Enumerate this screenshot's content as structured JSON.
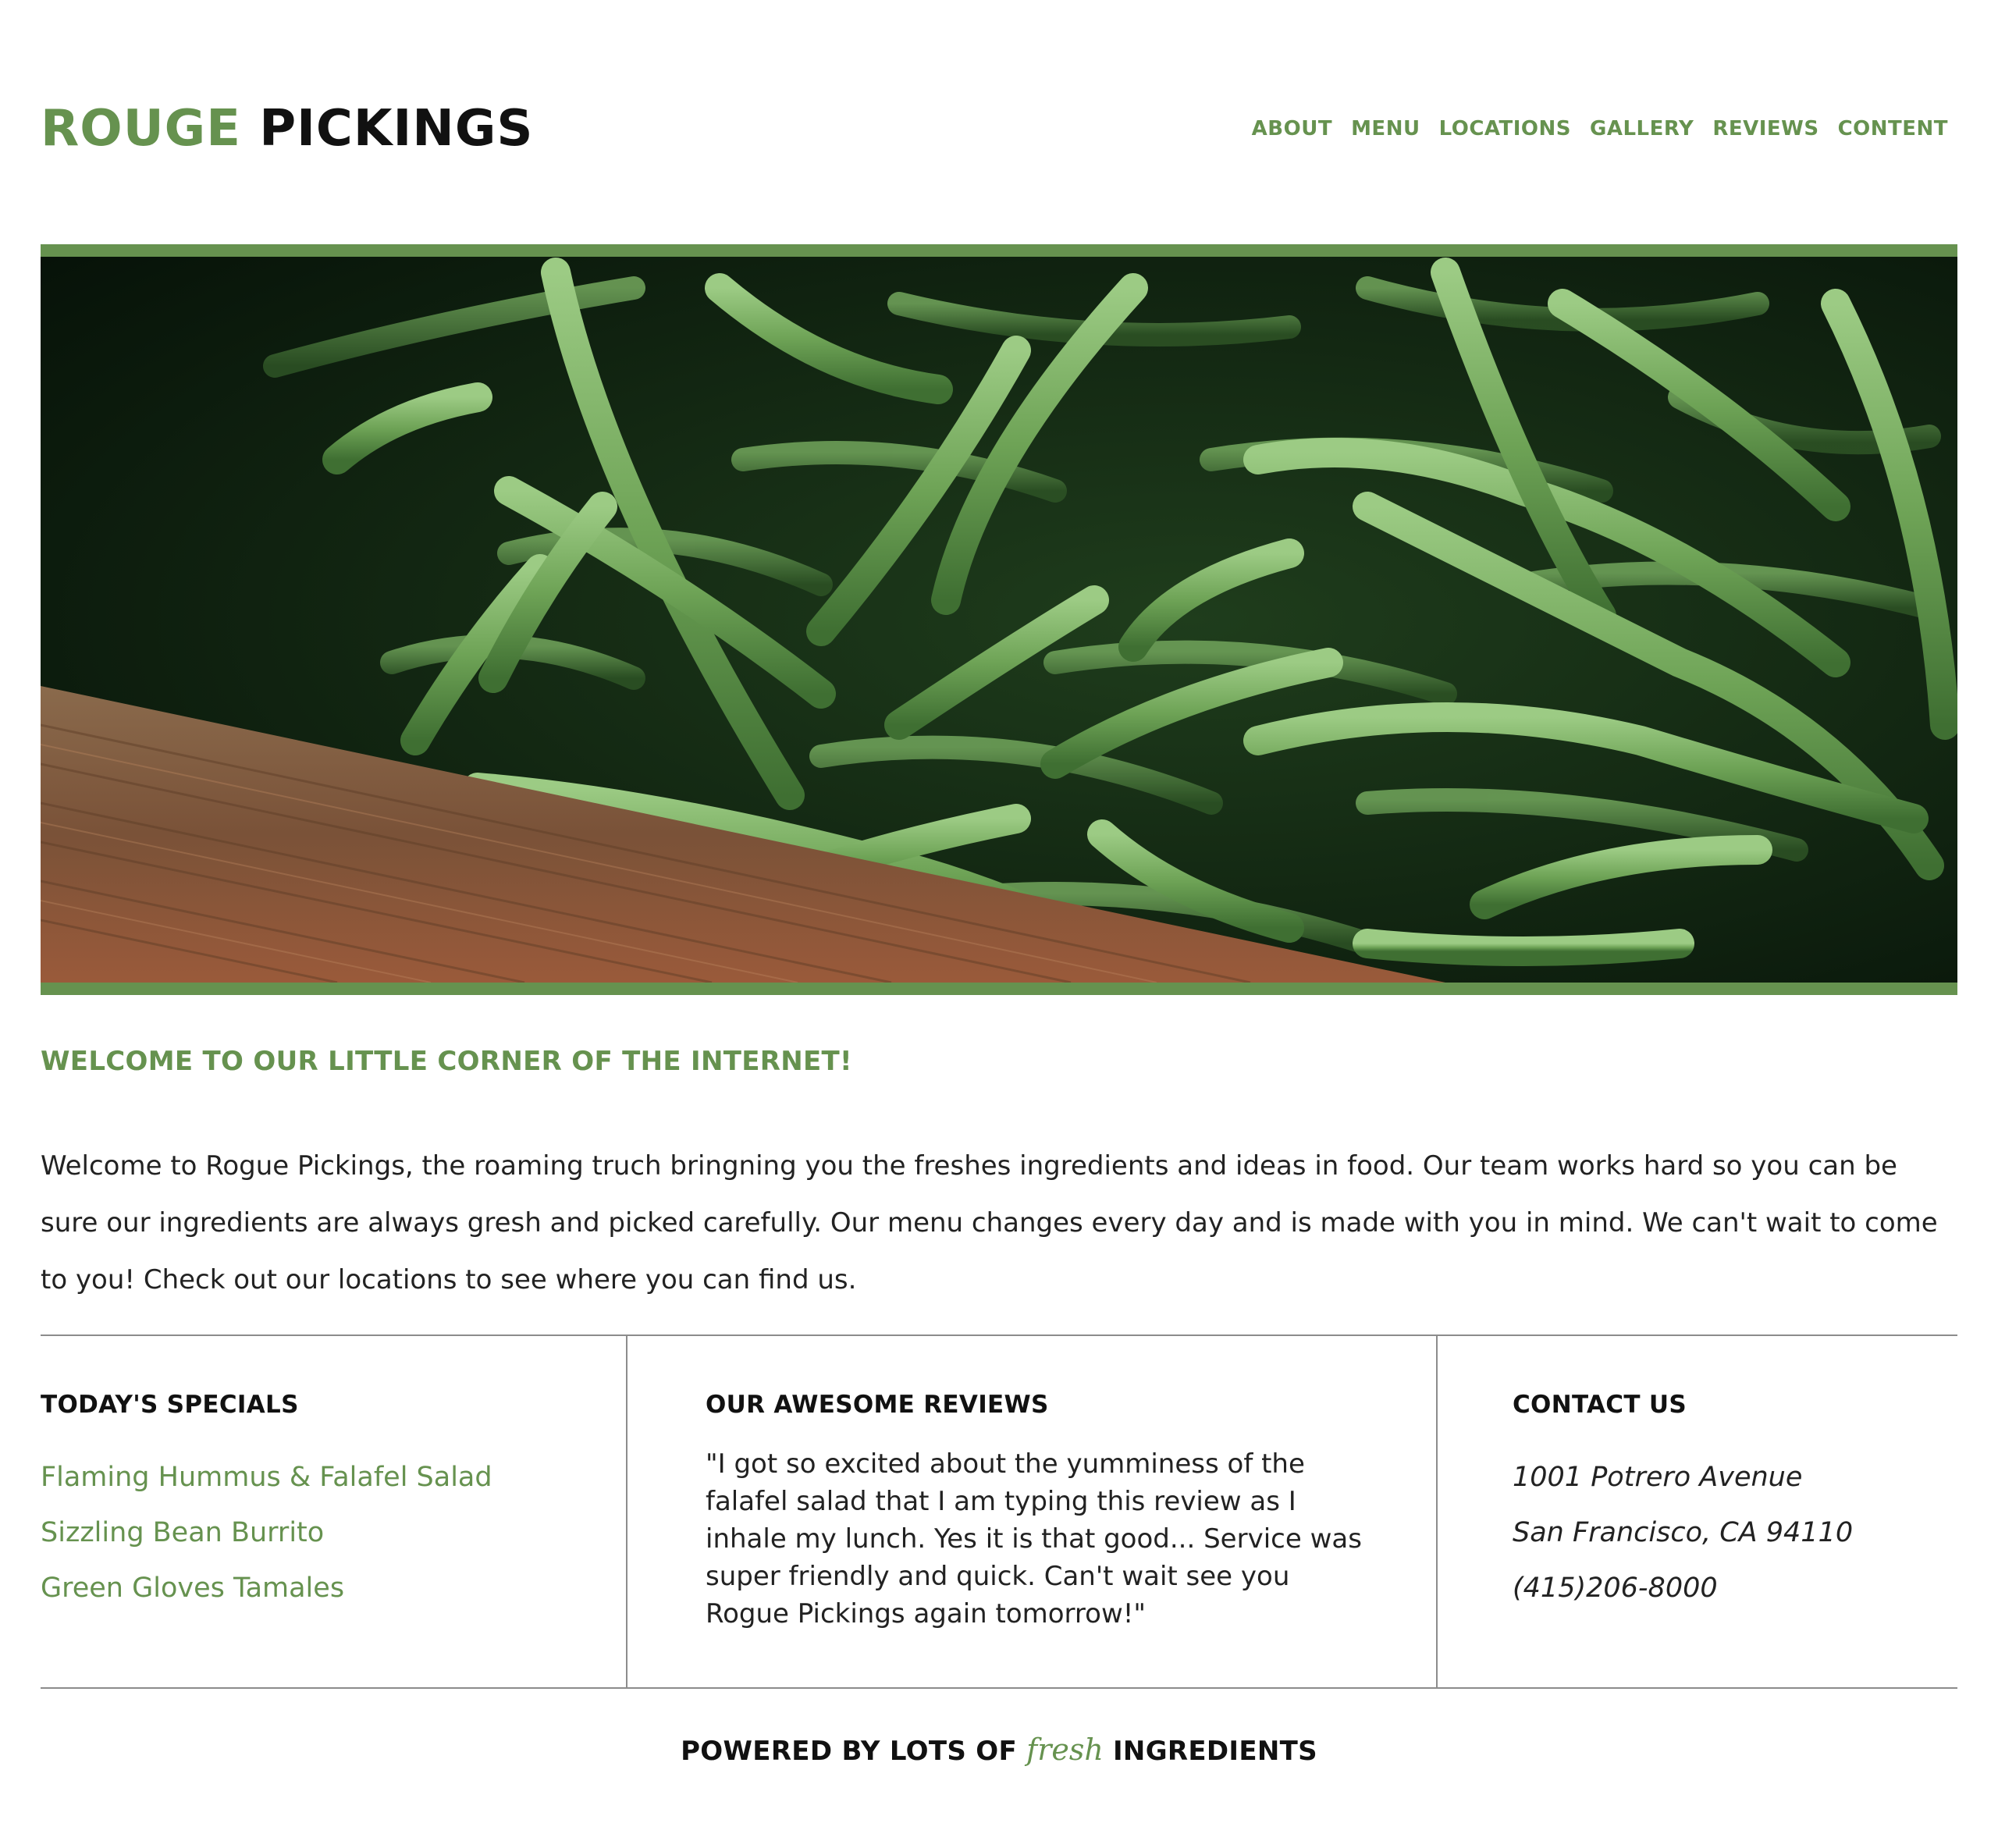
{
  "brand": {
    "word1": "ROUGE",
    "word2": "PICKINGS"
  },
  "nav": {
    "items": [
      {
        "label": "ABOUT"
      },
      {
        "label": "MENU"
      },
      {
        "label": "LOCATIONS"
      },
      {
        "label": "GALLERY"
      },
      {
        "label": "REVIEWS"
      },
      {
        "label": "CONTENT"
      }
    ]
  },
  "hero": {
    "image": "green-beans-in-wooden-crate-photo"
  },
  "welcome": {
    "heading": "WELCOME TO OUR LITTLE CORNER OF THE INTERNET!",
    "body": "Welcome to Rogue Pickings, the roaming truch bringning you the freshes ingredients and ideas in food. Our team works hard so you can be sure our ingredients are always gresh and picked carefully. Our menu changes every day and is made with you in mind. We can't wait to come to you! Check out our locations to see where you can find us."
  },
  "specials": {
    "heading": "TODAY'S SPECIALS",
    "items": [
      "Flaming Hummus & Falafel Salad",
      "Sizzling Bean Burrito",
      "Green Gloves Tamales"
    ]
  },
  "reviews": {
    "heading": "OUR AWESOME REVIEWS",
    "text": "\"I got so excited about the yumminess of the falafel salad that I am typing this review as I inhale my lunch. Yes it is that good... Service was super friendly and quick. Can't wait see you Rogue Pickings again tomorrow!\""
  },
  "contact": {
    "heading": "CONTACT US",
    "address_line1": "1001 Potrero Avenue",
    "address_line2": "San Francisco, CA 94110",
    "phone": "(415)206-8000"
  },
  "footer": {
    "prefix": "POWERED BY LOTS OF",
    "accent": "fresh",
    "suffix": "INGREDIENTS"
  },
  "colors": {
    "accent_green": "#66924f",
    "text_dark": "#111111",
    "body_text": "#222222",
    "divider": "#8c8c8c"
  }
}
